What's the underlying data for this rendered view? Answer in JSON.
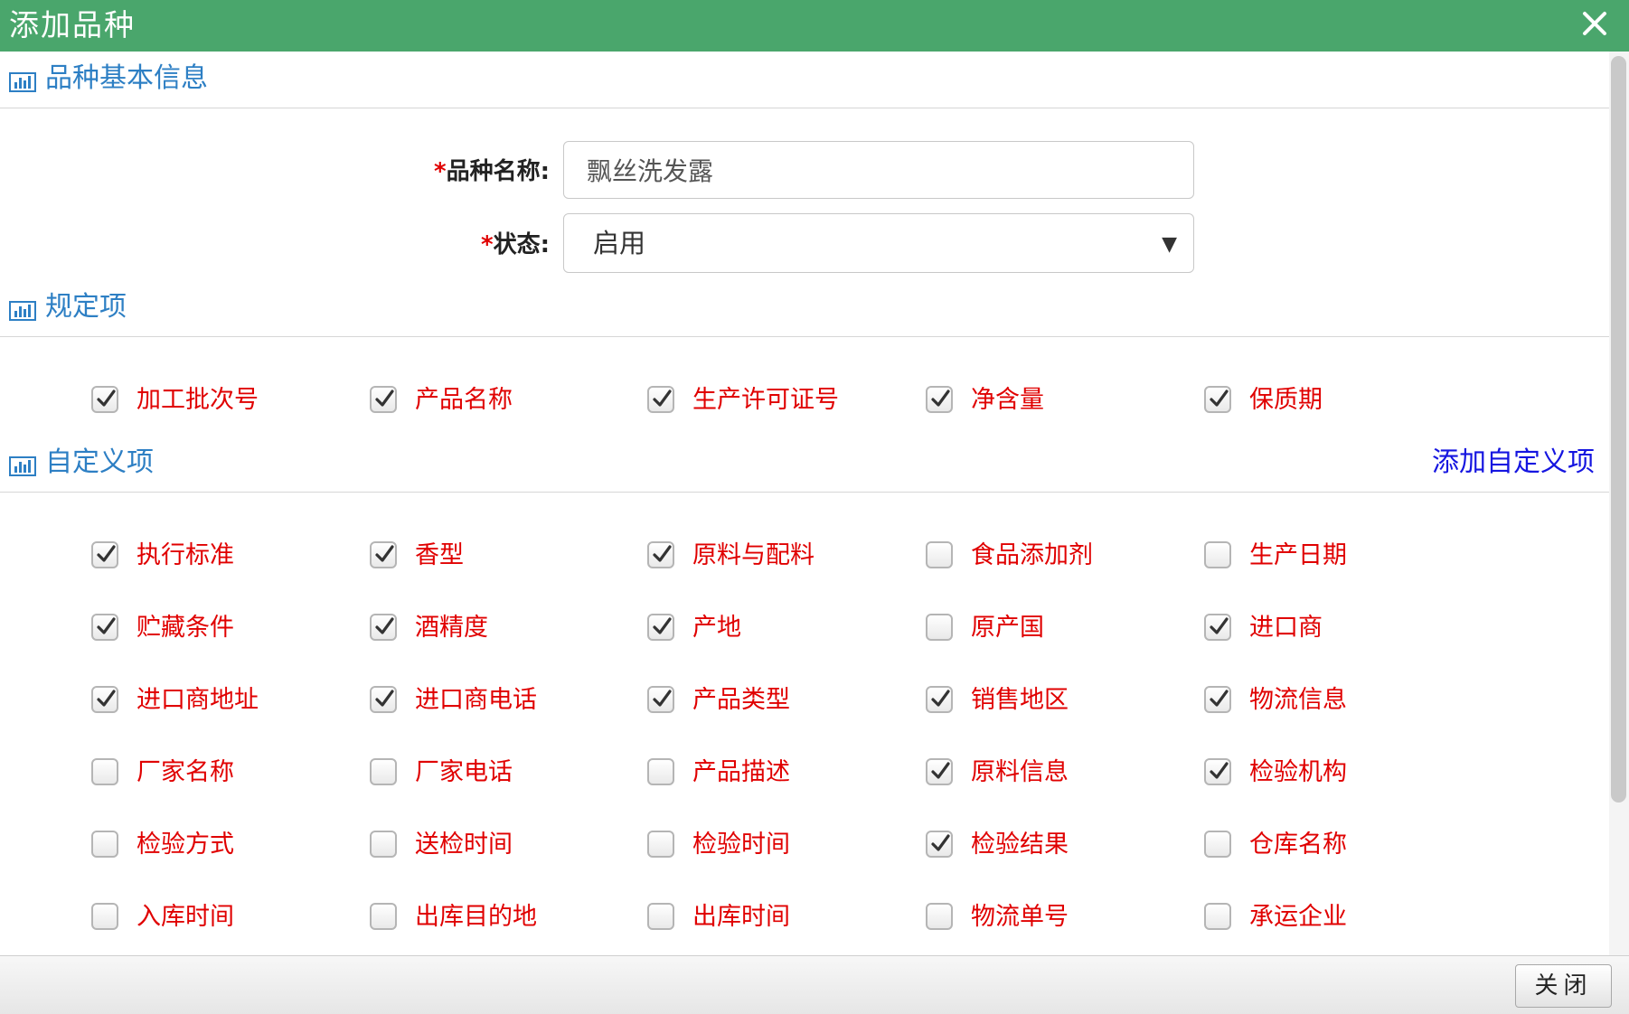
{
  "dialog": {
    "title": "添加品种",
    "close_icon": "close-icon"
  },
  "sections": {
    "basic": {
      "title": "品种基本信息",
      "icon": "bar-chart-icon"
    },
    "required": {
      "title": "规定项",
      "icon": "bar-chart-icon"
    },
    "custom": {
      "title": "自定义项",
      "icon": "bar-chart-icon",
      "add_link": "添加自定义项"
    }
  },
  "form": {
    "name": {
      "required_mark": "*",
      "label": "品种名称:",
      "value": "飘丝洗发露"
    },
    "status": {
      "required_mark": "*",
      "label": "状态:",
      "value": "启用"
    }
  },
  "required_items": [
    {
      "label": "加工批次号",
      "checked": true
    },
    {
      "label": "产品名称",
      "checked": true
    },
    {
      "label": "生产许可证号",
      "checked": true
    },
    {
      "label": "净含量",
      "checked": true
    },
    {
      "label": "保质期",
      "checked": true
    }
  ],
  "custom_items": [
    {
      "label": "执行标准",
      "checked": true
    },
    {
      "label": "香型",
      "checked": true
    },
    {
      "label": "原料与配料",
      "checked": true
    },
    {
      "label": "食品添加剂",
      "checked": false
    },
    {
      "label": "生产日期",
      "checked": false
    },
    {
      "label": "贮藏条件",
      "checked": true
    },
    {
      "label": "酒精度",
      "checked": true
    },
    {
      "label": "产地",
      "checked": true
    },
    {
      "label": "原产国",
      "checked": false
    },
    {
      "label": "进口商",
      "checked": true
    },
    {
      "label": "进口商地址",
      "checked": true
    },
    {
      "label": "进口商电话",
      "checked": true
    },
    {
      "label": "产品类型",
      "checked": true
    },
    {
      "label": "销售地区",
      "checked": true
    },
    {
      "label": "物流信息",
      "checked": true
    },
    {
      "label": "厂家名称",
      "checked": false
    },
    {
      "label": "厂家电话",
      "checked": false
    },
    {
      "label": "产品描述",
      "checked": false
    },
    {
      "label": "原料信息",
      "checked": true
    },
    {
      "label": "检验机构",
      "checked": true
    },
    {
      "label": "检验方式",
      "checked": false
    },
    {
      "label": "送检时间",
      "checked": false
    },
    {
      "label": "检验时间",
      "checked": false
    },
    {
      "label": "检验结果",
      "checked": true
    },
    {
      "label": "仓库名称",
      "checked": false
    },
    {
      "label": "入库时间",
      "checked": false
    },
    {
      "label": "出库目的地",
      "checked": false
    },
    {
      "label": "出库时间",
      "checked": false
    },
    {
      "label": "物流单号",
      "checked": false
    },
    {
      "label": "承运企业",
      "checked": false
    }
  ],
  "footer": {
    "close_label": "关闭"
  },
  "colors": {
    "titlebar": "#4aa66c",
    "section_title": "#2d7fc4",
    "item_label": "#e00000",
    "link": "#1515e0"
  }
}
